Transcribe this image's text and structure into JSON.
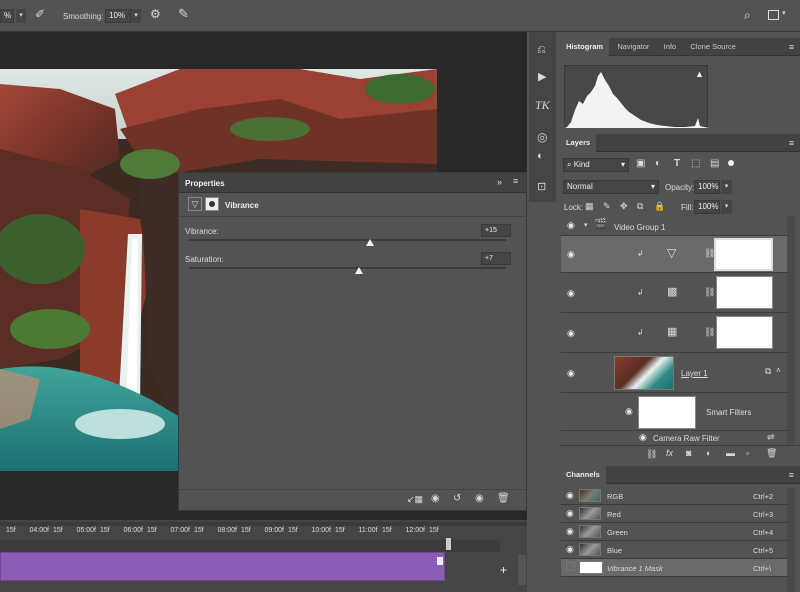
{
  "toolbar": {
    "zoom_partial": "%",
    "smoothing_label": "Smoothing:",
    "smoothing_value": "10%"
  },
  "properties": {
    "title": "Properties",
    "adjustment": "Vibrance",
    "vibrance_label": "Vibrance:",
    "vibrance_value": "+15",
    "vibrance_level": 15,
    "saturation_label": "Saturation:",
    "saturation_value": "+7",
    "saturation_level": 7
  },
  "timeline": {
    "ticks": [
      "15f",
      "04:00f",
      "15f",
      "05:00f",
      "15f",
      "06:00f",
      "15f",
      "07:00f",
      "15f",
      "08:00f",
      "15f",
      "09:00f",
      "15f",
      "10:00f",
      "15f",
      "11:00f",
      "15f",
      "12:00f",
      "15f"
    ]
  },
  "panel_tabs": {
    "histogram": "Histogram",
    "navigator": "Navigator",
    "info": "Info",
    "clone_source": "Clone Source"
  },
  "layers": {
    "tab": "Layers",
    "filter_kind": "Kind",
    "blend_mode": "Normal",
    "opacity_label": "Opacity:",
    "opacity_value": "100%",
    "lock_label": "Lock:",
    "fill_label": "Fill:",
    "fill_value": "100%",
    "group_name": "Video Group 1",
    "layer1_name": "Layer 1",
    "smart_filters_label": "Smart Filters",
    "camera_raw_label": "Camera Raw Filter"
  },
  "channels": {
    "tab": "Channels",
    "rows": [
      {
        "name": "RGB",
        "shortcut": "Ctrl+2"
      },
      {
        "name": "Red",
        "shortcut": "Ctrl+3"
      },
      {
        "name": "Green",
        "shortcut": "Ctrl+4"
      },
      {
        "name": "Blue",
        "shortcut": "Ctrl+5"
      },
      {
        "name": "Vibrance 1 Mask",
        "shortcut": "Ctrl+\\"
      }
    ]
  }
}
